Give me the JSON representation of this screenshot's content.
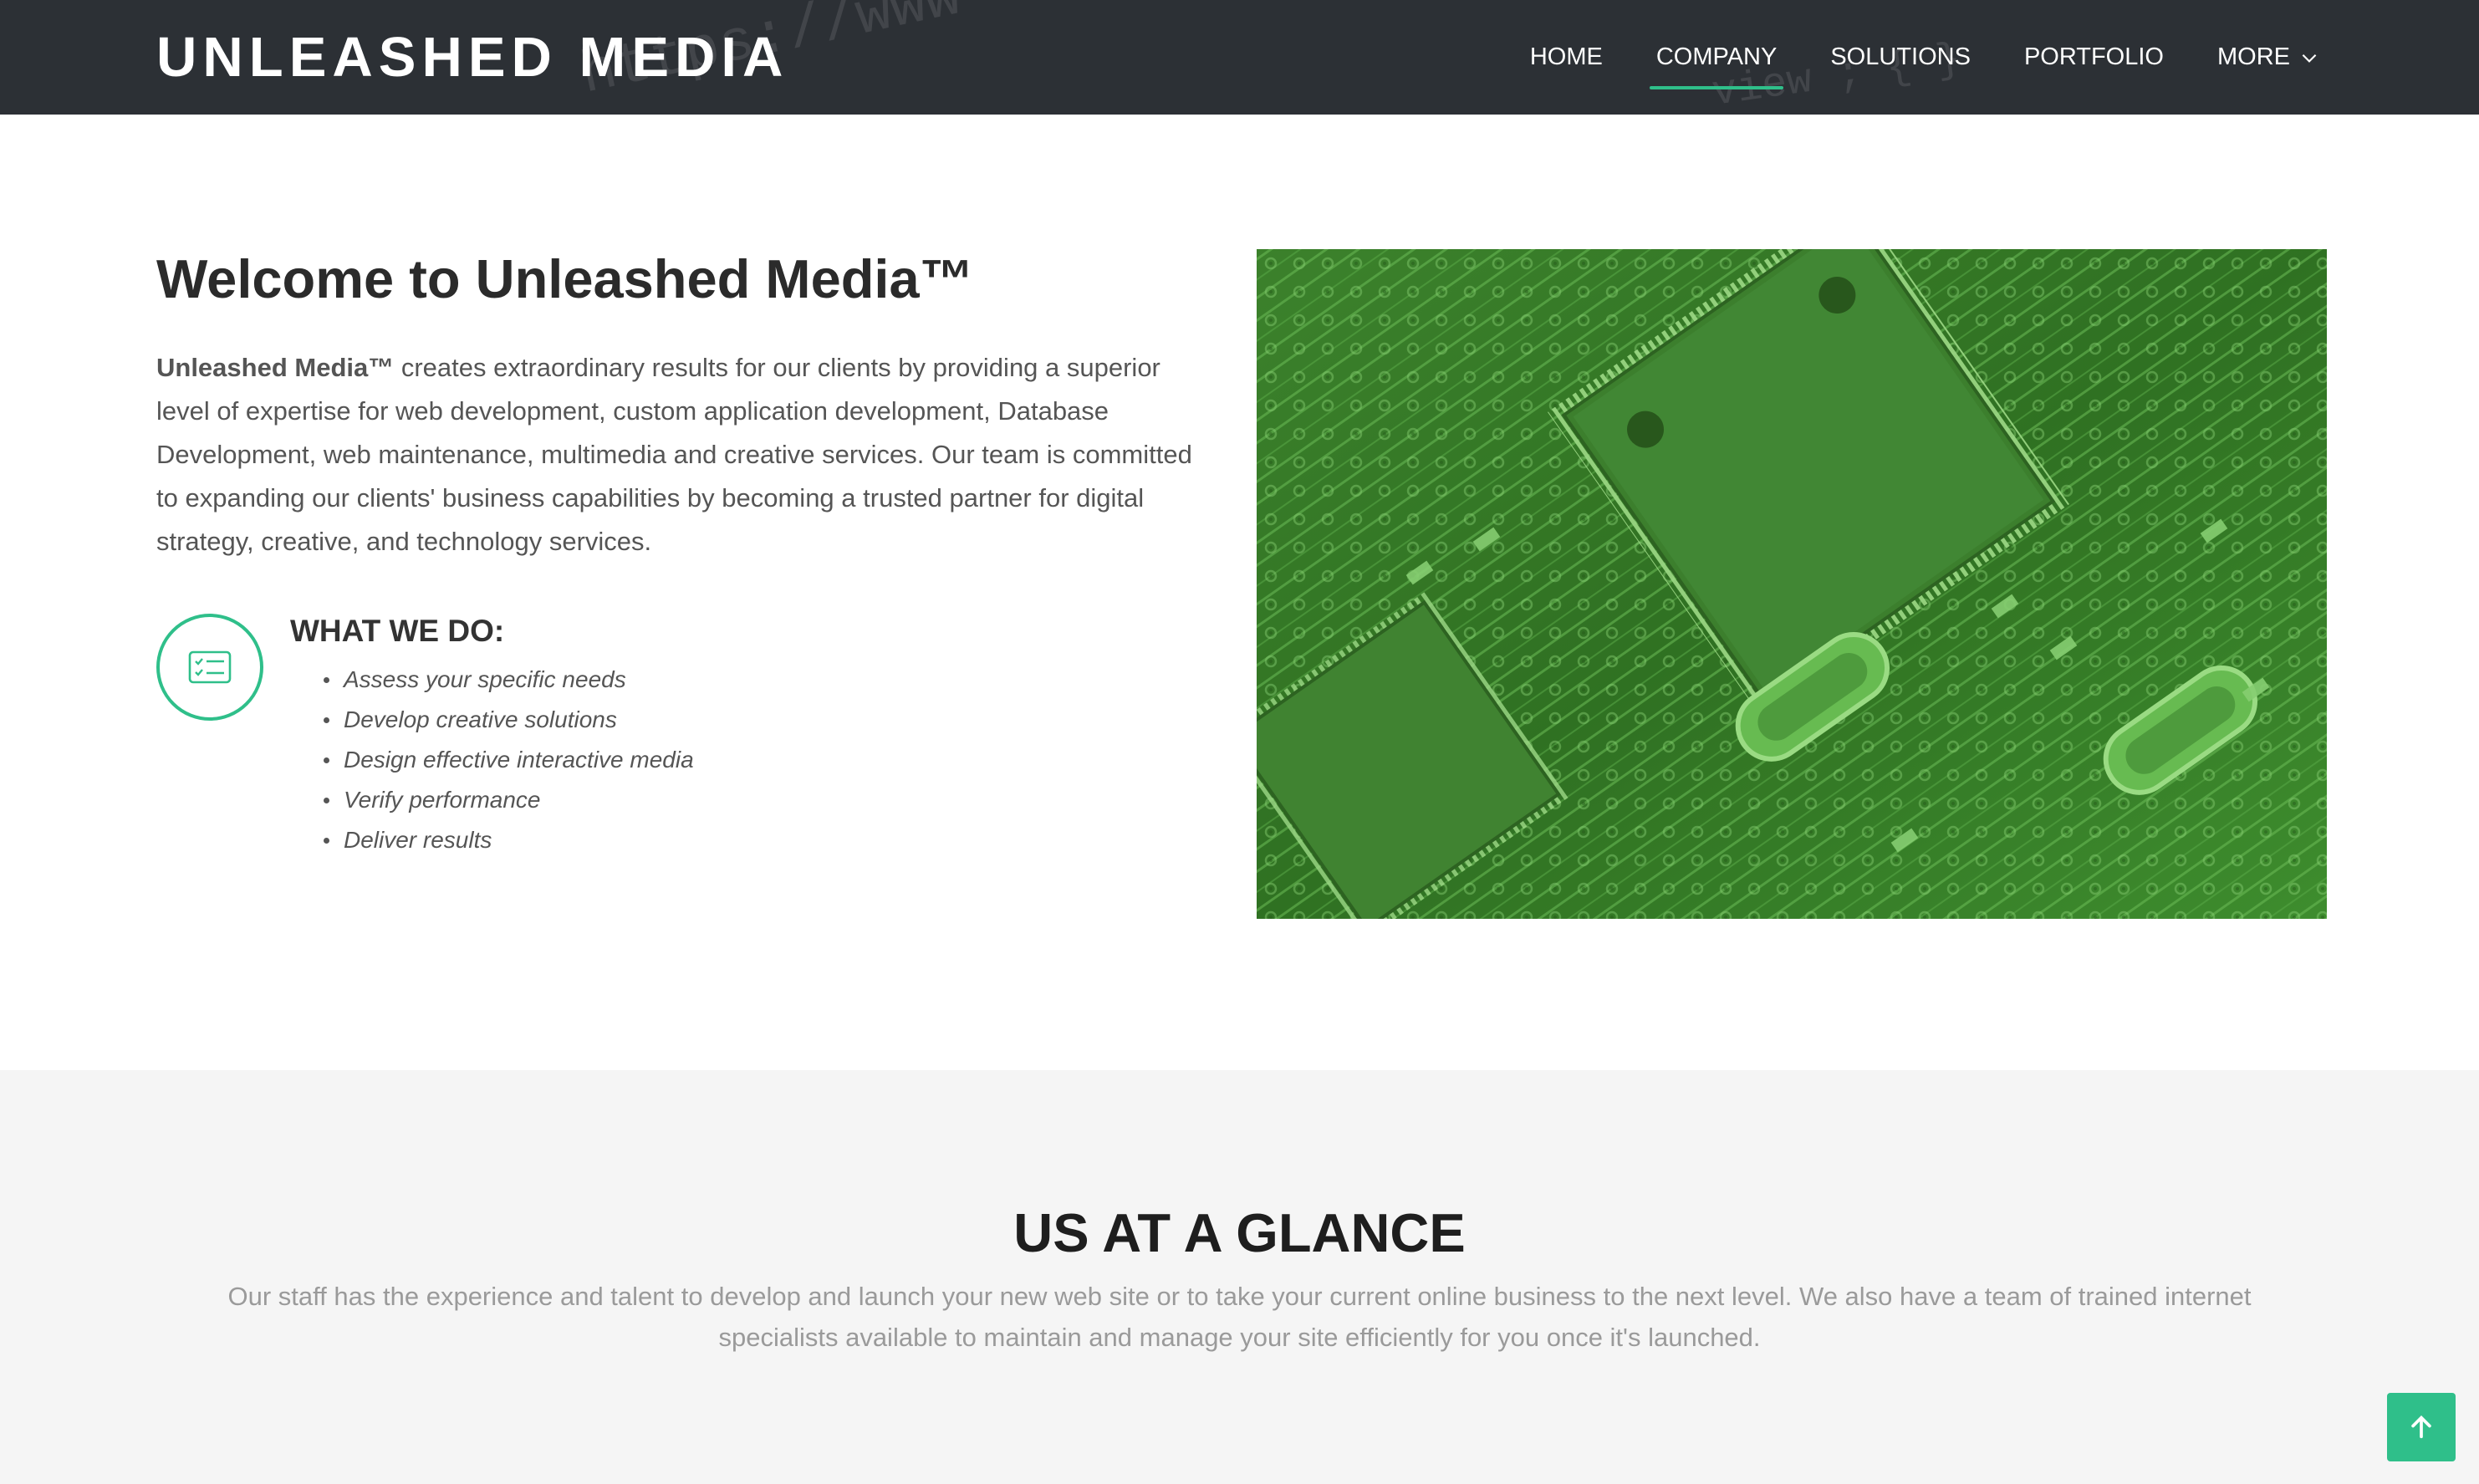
{
  "brand": {
    "name": "UNLEASHED MEDIA",
    "accent": "#2fbf8a",
    "header_bg": "#2c3035"
  },
  "nav": {
    "items": [
      {
        "label": "HOME"
      },
      {
        "label": "COMPANY",
        "active": true
      },
      {
        "label": "SOLUTIONS"
      },
      {
        "label": "PORTFOLIO"
      },
      {
        "label": "MORE",
        "icon": "chevron-down-icon"
      }
    ]
  },
  "welcome": {
    "title": "Welcome to Unleashed Media™",
    "intro_bold": "Unleashed Media™",
    "intro_rest": " creates extraordinary results for our clients by providing a superior level of expertise for web development, custom application development, Database Development, web maintenance, multimedia and creative services. Our team is committed to expanding our clients' business capabilities by becoming a trusted partner for digital strategy, creative, and technology services."
  },
  "what_we_do": {
    "icon": "checklist-icon",
    "title": "WHAT WE DO:",
    "items": [
      "Assess your specific needs",
      "Develop creative solutions",
      "Design effective interactive media",
      "Verify performance",
      "Deliver results"
    ]
  },
  "hero_image": {
    "subject": "green circuit board",
    "icon": "circuit-board-image"
  },
  "glance": {
    "title": "US AT A GLANCE",
    "text": "Our staff has the experience and talent to develop and launch your new web site or to take your current online business to the next level. We also have a team of trained internet specialists available to maintain and manage your site efficiently for you once it's launched."
  },
  "back_to_top": {
    "icon": "arrow-up-icon"
  }
}
